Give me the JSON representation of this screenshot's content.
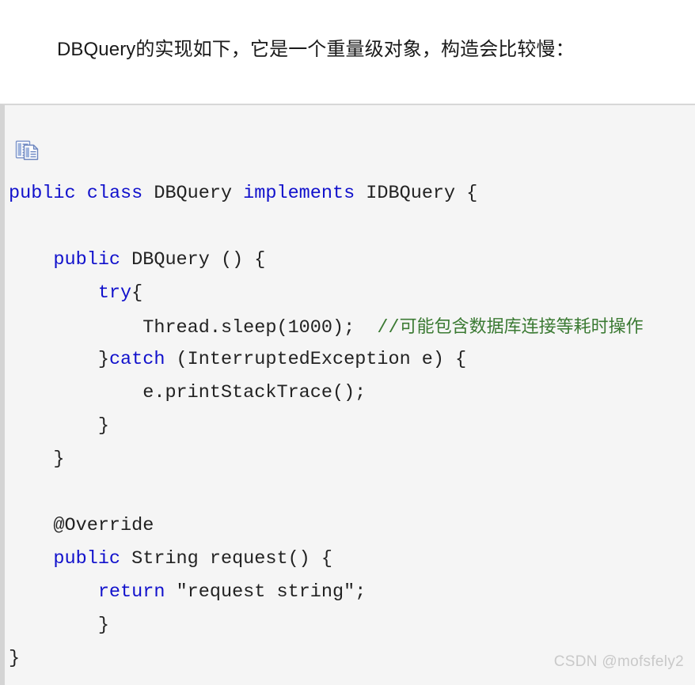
{
  "page": {
    "background_color": "#ffffff"
  },
  "intro": {
    "text": "DBQuery的实现如下，它是一个重量级对象，构造会比较慢："
  },
  "code_block": {
    "background_color": "#f5f5f5",
    "border_color": "#d4d4d4",
    "copy_icon": "copy-document-icon",
    "copy_icon_color": "#5b7fc7",
    "language": "java",
    "colors": {
      "keyword": "#1111cc",
      "plain": "#222222",
      "comment": "#3b7a33",
      "string": "#222222"
    },
    "lines": [
      {
        "indent": 0,
        "tokens": [
          {
            "type": "kw",
            "text": "public"
          },
          {
            "type": "plain",
            "text": " "
          },
          {
            "type": "kw",
            "text": "class"
          },
          {
            "type": "plain",
            "text": " DBQuery "
          },
          {
            "type": "kw",
            "text": "implements"
          },
          {
            "type": "plain",
            "text": " IDBQuery {"
          }
        ]
      },
      {
        "indent": 0,
        "tokens": []
      },
      {
        "indent": 1,
        "tokens": [
          {
            "type": "kw",
            "text": "public"
          },
          {
            "type": "plain",
            "text": " DBQuery () {"
          }
        ]
      },
      {
        "indent": 2,
        "tokens": [
          {
            "type": "kw",
            "text": "try"
          },
          {
            "type": "plain",
            "text": "{"
          }
        ]
      },
      {
        "indent": 3,
        "tokens": [
          {
            "type": "plain",
            "text": "Thread.sleep(1000);  "
          },
          {
            "type": "cmt-slash",
            "text": "//"
          },
          {
            "type": "cmt",
            "text": "可能包含数据库连接等耗时操作"
          }
        ]
      },
      {
        "indent": 2,
        "tokens": [
          {
            "type": "plain",
            "text": "}"
          },
          {
            "type": "kw",
            "text": "catch"
          },
          {
            "type": "plain",
            "text": " (InterruptedException e) {"
          }
        ]
      },
      {
        "indent": 3,
        "tokens": [
          {
            "type": "plain",
            "text": "e.printStackTrace();"
          }
        ]
      },
      {
        "indent": 2,
        "tokens": [
          {
            "type": "plain",
            "text": "}"
          }
        ]
      },
      {
        "indent": 1,
        "tokens": [
          {
            "type": "plain",
            "text": "}"
          }
        ]
      },
      {
        "indent": 0,
        "tokens": []
      },
      {
        "indent": 1,
        "tokens": [
          {
            "type": "plain",
            "text": "@Override"
          }
        ]
      },
      {
        "indent": 1,
        "tokens": [
          {
            "type": "kw",
            "text": "public"
          },
          {
            "type": "plain",
            "text": " String request() {"
          }
        ]
      },
      {
        "indent": 2,
        "tokens": [
          {
            "type": "kw",
            "text": "return"
          },
          {
            "type": "plain",
            "text": " "
          },
          {
            "type": "str",
            "text": "\"request string\""
          },
          {
            "type": "plain",
            "text": ";"
          }
        ]
      },
      {
        "indent": 2,
        "tokens": [
          {
            "type": "plain",
            "text": "}"
          }
        ]
      },
      {
        "indent": 0,
        "tokens": [
          {
            "type": "plain",
            "text": "}"
          }
        ]
      }
    ]
  },
  "watermark": {
    "text": "CSDN @mofsfely2",
    "color": "#c9c9c9"
  }
}
